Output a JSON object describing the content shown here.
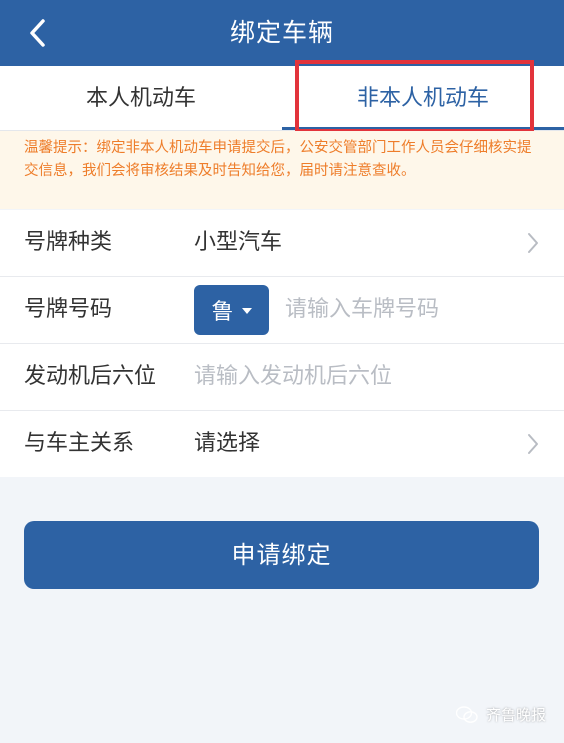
{
  "header": {
    "title": "绑定车辆"
  },
  "tabs": [
    {
      "label": "本人机动车"
    },
    {
      "label": "非本人机动车"
    }
  ],
  "notice": {
    "text": "温馨提示：绑定非本人机动车申请提交后，公安交管部门工作人员会仔细核实提交信息，我们会将审核结果及时告知给您，届时请注意查收。"
  },
  "form": {
    "plate_type": {
      "label": "号牌种类",
      "value": "小型汽车"
    },
    "plate_number": {
      "label": "号牌号码",
      "province": "鲁",
      "placeholder": "请输入车牌号码"
    },
    "engine": {
      "label": "发动机后六位",
      "placeholder": "请输入发动机后六位"
    },
    "relation": {
      "label": "与车主关系",
      "value": "请选择"
    }
  },
  "submit": {
    "label": "申请绑定"
  },
  "watermark": {
    "text": "齐鲁晚报"
  },
  "colors": {
    "brand": "#2d62a4",
    "notice_text": "#ee7d2a",
    "notice_bg": "#fef7ea",
    "highlight": "#e2333b"
  }
}
